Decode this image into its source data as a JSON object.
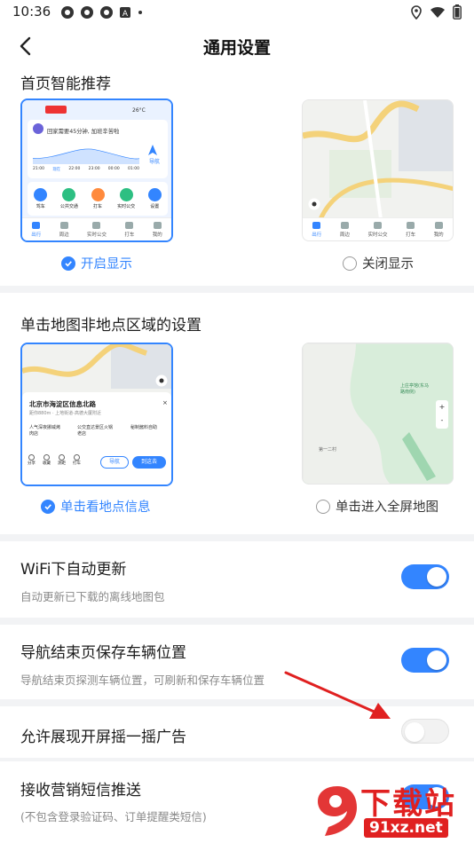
{
  "status_bar": {
    "time": "10:36"
  },
  "header": {
    "title": "通用设置"
  },
  "homepage": {
    "title": "首页智能推荐",
    "option_on": "开启显示",
    "option_off": "关闭显示",
    "card_text": "回家需要45分钟, 加班辛苦啦",
    "card_nav": "导航",
    "weather": "26°C",
    "quick_actions": [
      "驾车",
      "公共交通",
      "打车",
      "实时公交",
      "设置"
    ],
    "tabs": [
      "出行",
      "周边",
      "实时公交",
      "打车",
      "我的"
    ],
    "times": [
      "21:00",
      "现在",
      "22:00",
      "23:00",
      "00:00",
      "01:00"
    ]
  },
  "map_click": {
    "title": "单击地图非地点区域的设置",
    "option_info": "单击看地点信息",
    "option_fullscreen": "单击进入全屏地图",
    "place_name": "北京市海淀区信息北路",
    "place_sub": "距你880m · 上地街道-高德大厦附近",
    "poi_1": "人气深夜挪威烤肉店",
    "poi_2": "公交直达景区火锅老店",
    "poi_3": "秘制酱料自助",
    "nav_button": "导航",
    "go_button": "到这去",
    "small_actions": [
      "分享",
      "收藏",
      "测距",
      "打车"
    ],
    "map_label": "上庄亭馆(东马路南侧)",
    "road_label": "第一二村"
  },
  "wifi_update": {
    "title": "WiFi下自动更新",
    "subtitle": "自动更新已下载的离线地图包",
    "enabled": true
  },
  "save_parking": {
    "title": "导航结束页保存车辆位置",
    "subtitle": "导航结束页探测车辆位置，可刷新和保存车辆位置",
    "enabled": true
  },
  "shake_ad": {
    "title": "允许展现开屏摇一摇广告",
    "enabled": false
  },
  "sms_push": {
    "title": "接收营销短信推送",
    "subtitle": "(不包含登录验证码、订单提醒类短信)",
    "enabled": true
  },
  "watermark": {
    "text": "下载站",
    "url": "91xz.net"
  },
  "colors": {
    "accent": "#3385ff",
    "divider": "#f2f3f5",
    "arrow": "#e02020"
  }
}
